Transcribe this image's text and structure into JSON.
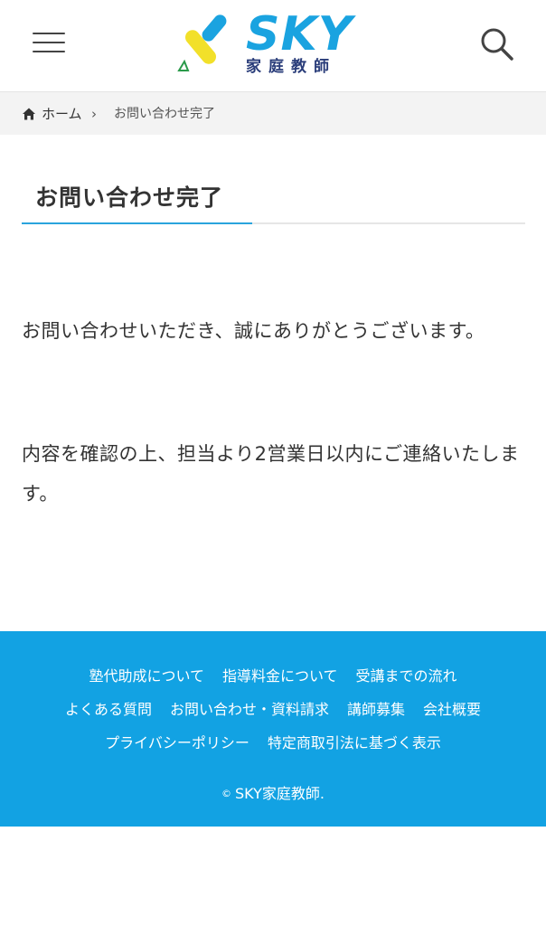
{
  "header": {
    "logo_text": "SKY",
    "logo_subtitle": "家庭教師",
    "colors": {
      "logo_blue": "#1aa3e0",
      "logo_yellow": "#f2e02a",
      "logo_navy": "#2a3d7a"
    },
    "menu_icon": "hamburger-menu-icon",
    "search_icon": "search-icon"
  },
  "breadcrumb": {
    "home_label": "ホーム",
    "separator": "›",
    "current": "お問い合わせ完了"
  },
  "main": {
    "title": "お問い合わせ完了",
    "paragraphs": [
      "お問い合わせいただき、誠にありがとうございます。",
      "内容を確認の上、担当より2営業日以内にご連絡いたします。"
    ]
  },
  "footer": {
    "background": "#12a2e3",
    "links_row1": [
      "塾代助成について",
      "指導料金について",
      "受講までの流れ"
    ],
    "links_row2": [
      "よくある質問",
      "お問い合わせ・資料請求",
      "講師募集",
      "会社概要"
    ],
    "links_row3": [
      "プライバシーポリシー",
      "特定商取引法に基づく表示"
    ],
    "copyright_symbol": "©",
    "copyright_text": "SKY家庭教師."
  }
}
